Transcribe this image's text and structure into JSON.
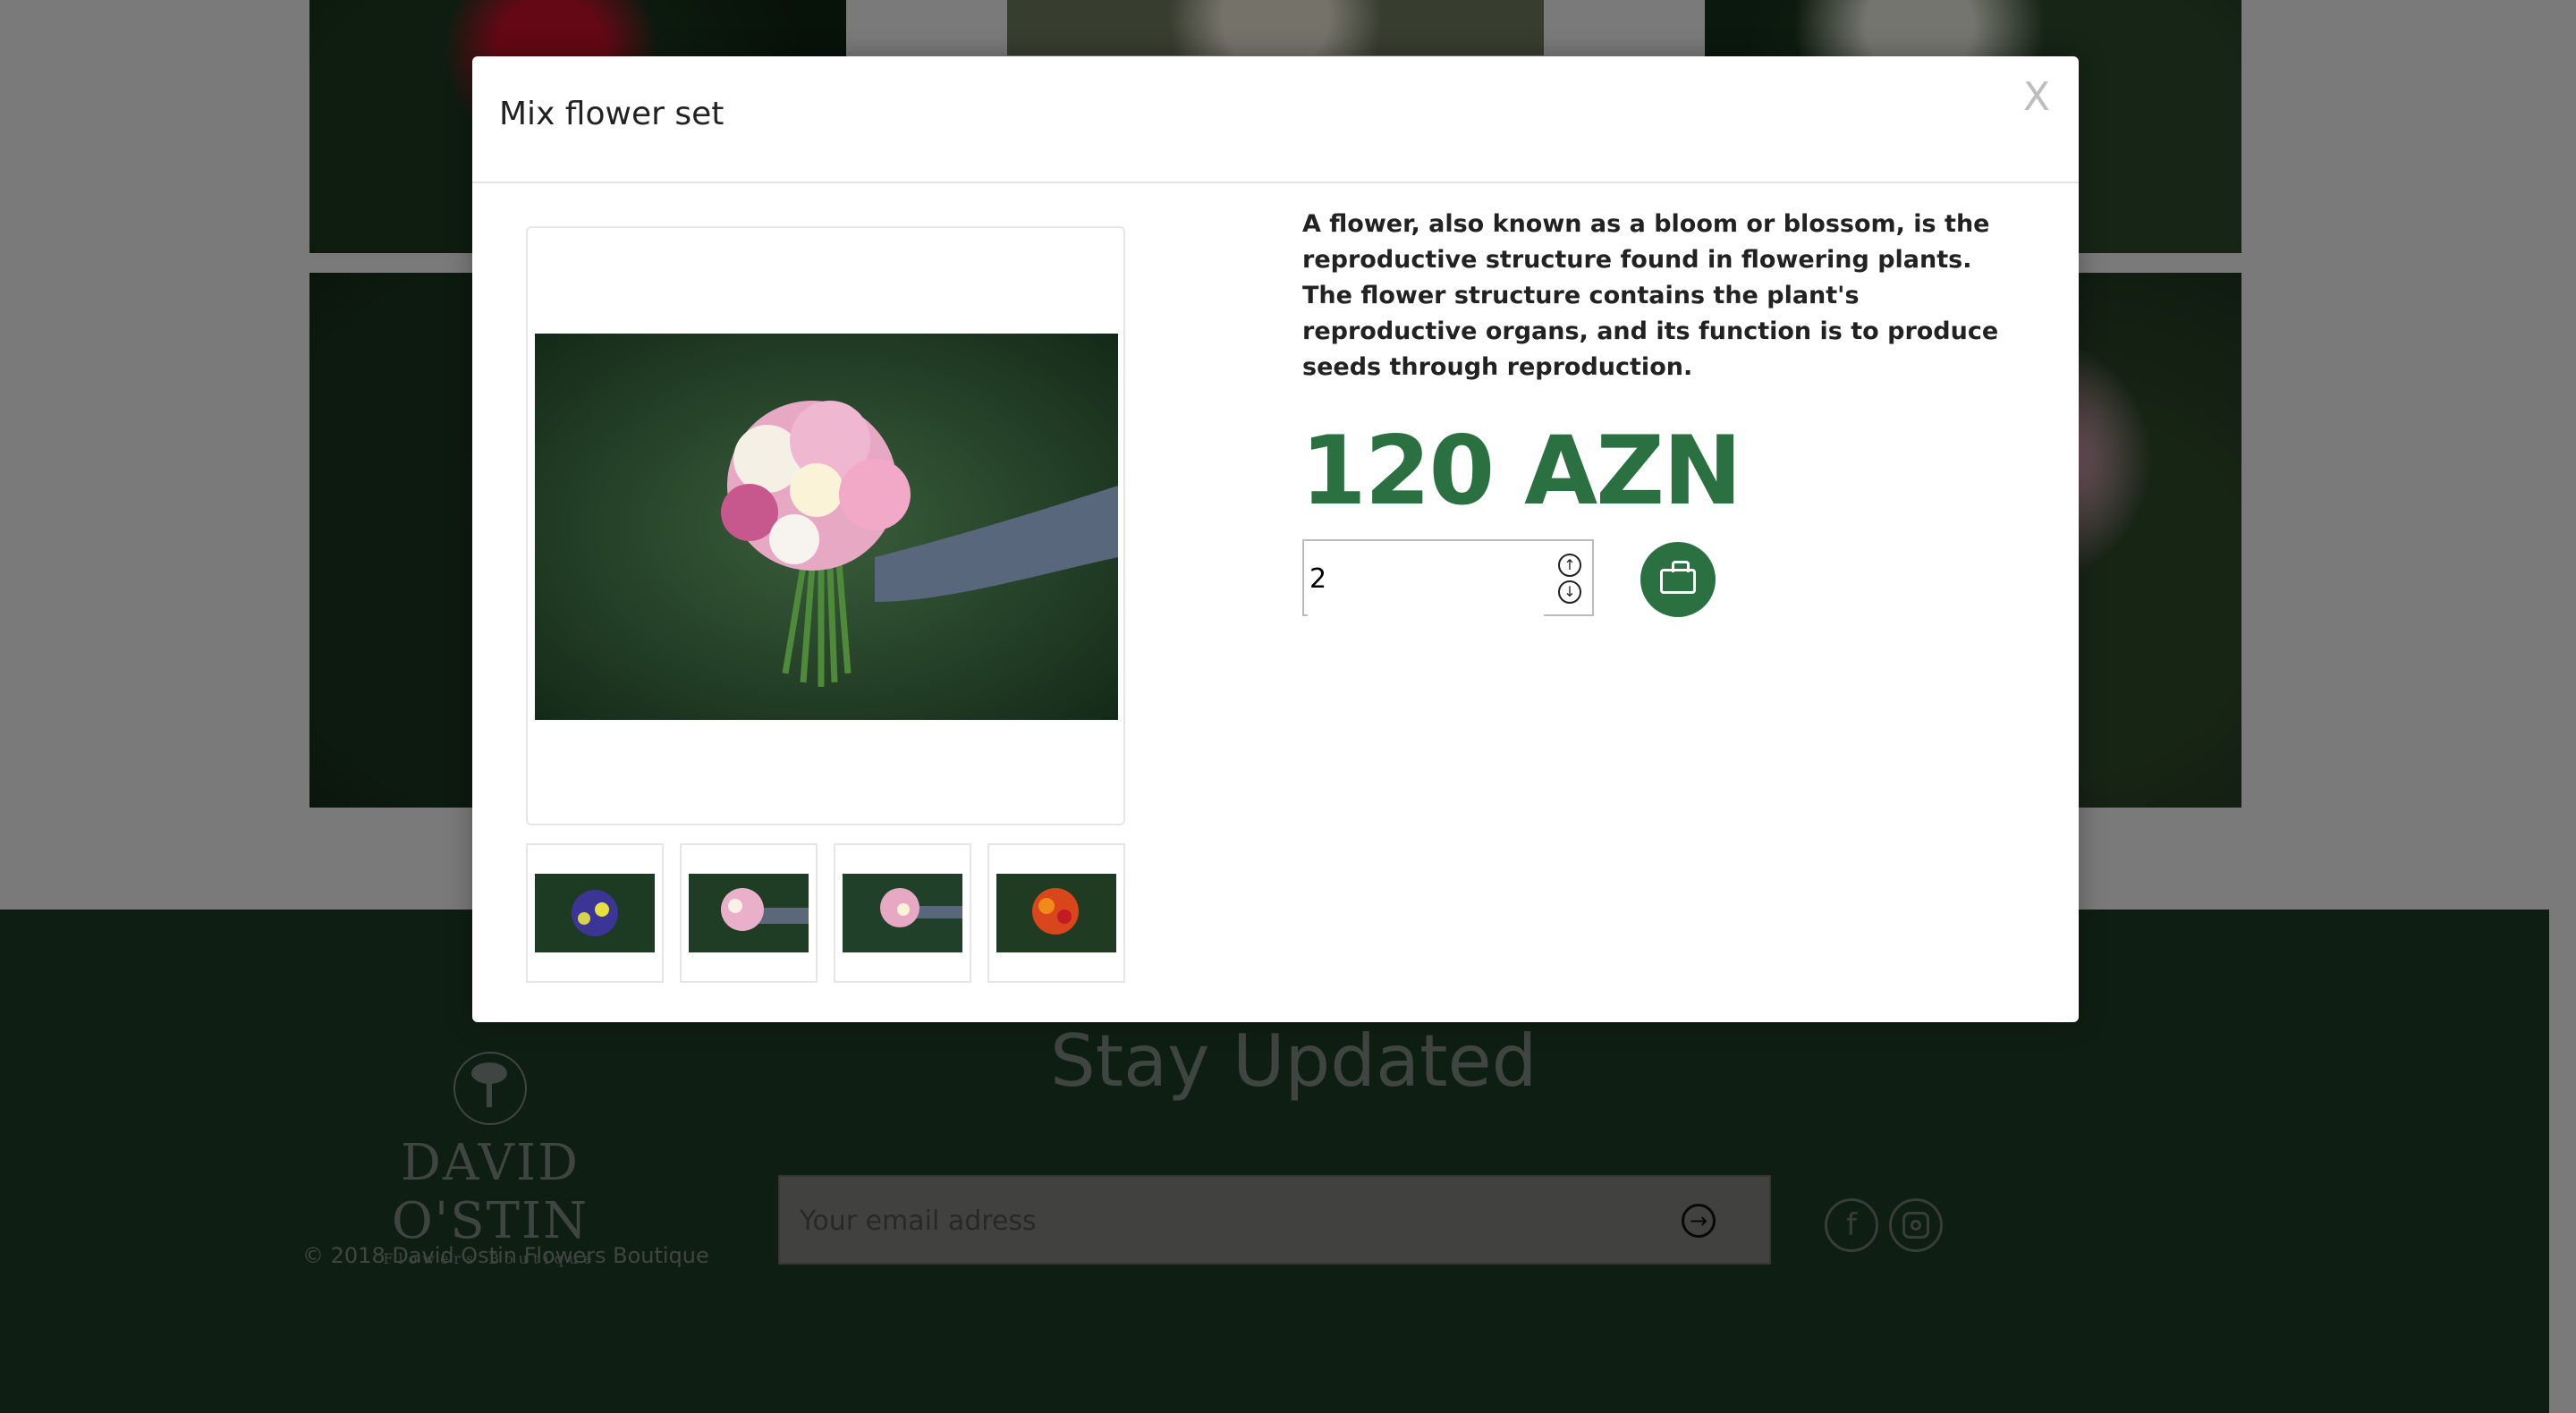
{
  "modal": {
    "title": "Mix flower set",
    "close_label": "X",
    "description": "A flower, also known as a bloom or blossom, is the reproductive structure found in flowering plants. The flower structure contains the plant's reproductive organs, and its function is to produce seeds through reproduction.",
    "price": "120 AZN",
    "quantity": "2",
    "thumbnails": [
      {
        "name": "thumbnail-blue-bouquet",
        "icon": "photo-blue-flowers"
      },
      {
        "name": "thumbnail-pink-bouquet",
        "icon": "photo-pink-flowers"
      },
      {
        "name": "thumbnail-mix-bouquet",
        "icon": "photo-mix-flowers"
      },
      {
        "name": "thumbnail-red-bouquet",
        "icon": "photo-red-flowers"
      }
    ]
  },
  "footer": {
    "heading": "Stay Updated",
    "logo_name": "DAVID O'STIN",
    "logo_sub": "Flowers Boutique",
    "copyright": "© 2018 David Ostin Flowers Boutique",
    "email_placeholder": "Your email adress",
    "facebook_glyph": "f"
  },
  "colors": {
    "brand_green": "#2b7041",
    "footer_bg": "#1e3d24"
  }
}
